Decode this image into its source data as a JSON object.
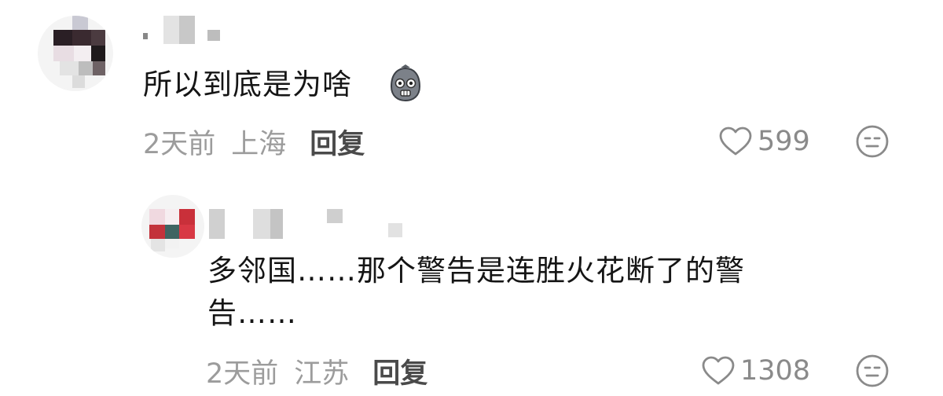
{
  "comments": [
    {
      "text": "所以到底是为啥",
      "emoji": "grimace-emoji",
      "time": "2天前",
      "location": "上海",
      "reply_label": "回复",
      "likes": "599"
    }
  ],
  "reply": {
    "text_line1": "多邻国……那个警告是连胜火花断了的警",
    "text_line2": "告……",
    "time": "2天前",
    "location": "江苏",
    "reply_label": "回复",
    "likes": "1308"
  },
  "icons": {
    "like": "heart-outline-icon",
    "dislike": "neutral-face-icon"
  },
  "colors": {
    "text": "#151515",
    "meta": "#9c9c9c",
    "reply_action": "#4a4a4a",
    "icon": "#8a8a8a"
  }
}
